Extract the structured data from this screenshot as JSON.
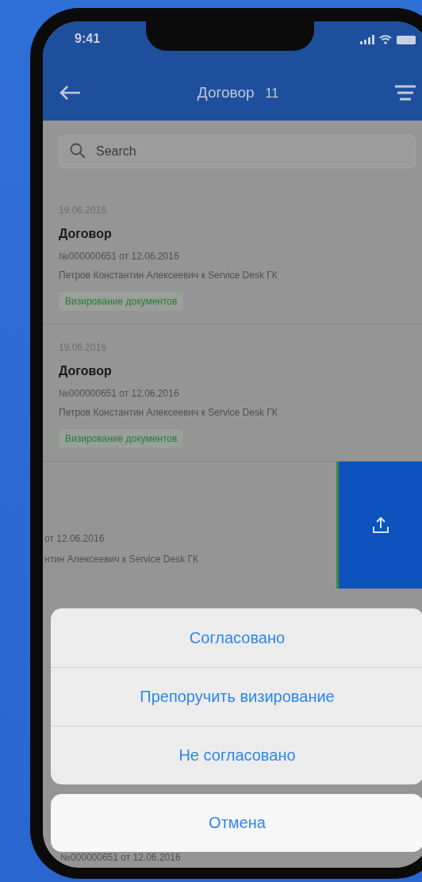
{
  "status_bar": {
    "time": "9:41"
  },
  "header": {
    "title": "Договор",
    "count": "11"
  },
  "search": {
    "placeholder": "Search"
  },
  "documents": [
    {
      "date": "19.06.2016",
      "title": "Договор",
      "number": "№000000651 от 12.06.2016",
      "author": "Петров Константин Алексеевич к Service Desk ГК",
      "tag": "Визирование документов"
    },
    {
      "date": "19.06.2016",
      "title": "Договор",
      "number": "№000000651 от 12.06.2016",
      "author": "Петров Константин Алексеевич к Service Desk ГК",
      "tag": "Визирование документов"
    }
  ],
  "swiped_document": {
    "number": "от 12.06.2016",
    "author": "нтин Алексеевич к Service Desk ГК"
  },
  "action_sheet": {
    "actions": [
      "Согласовано",
      "Препоручить визирование",
      "Не согласовано"
    ],
    "cancel": "Отмена"
  },
  "next_document": {
    "number": "№000000651 от 12.06.2016"
  }
}
